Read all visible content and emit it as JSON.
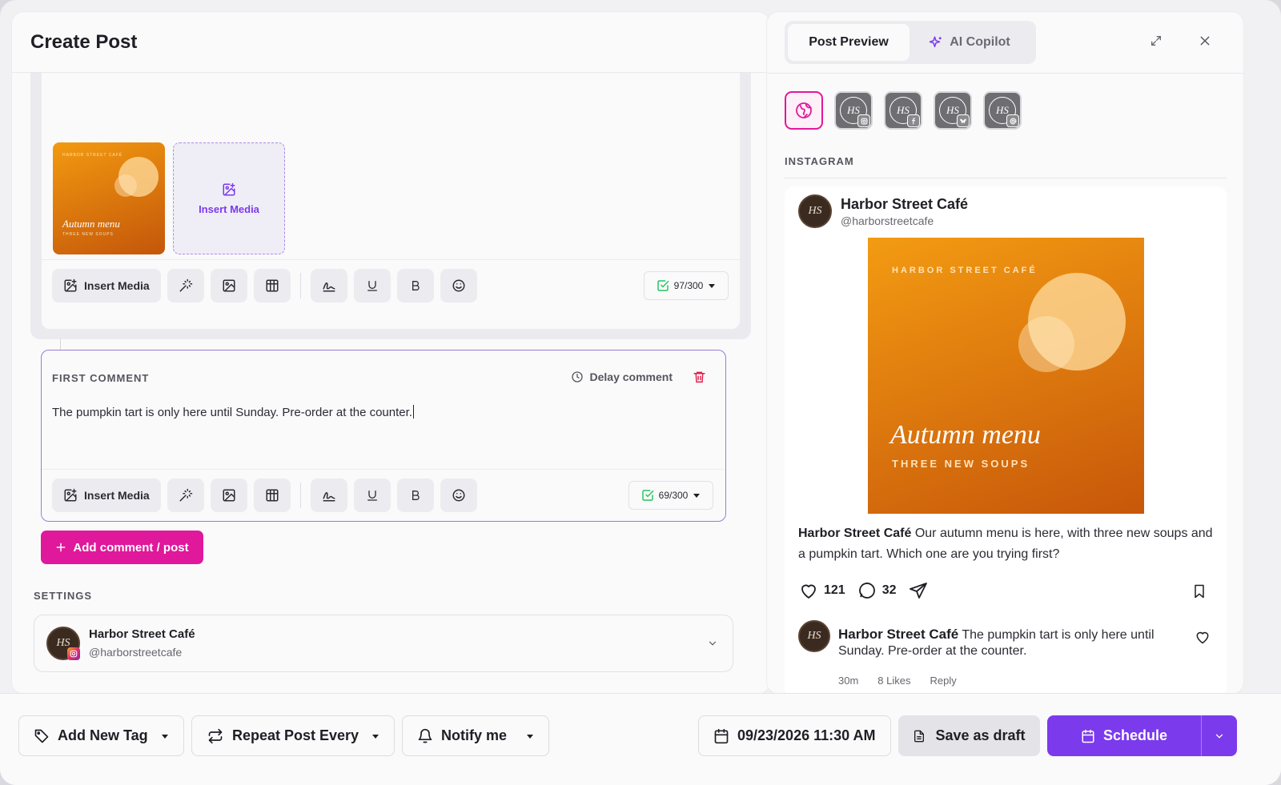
{
  "header": {
    "title": "Create Post"
  },
  "editor": {
    "thumb": {
      "brand": "HARBOR STREET CAFÉ",
      "title": "Autumn menu",
      "subtitle": "THREE NEW SOUPS"
    },
    "insert_tile_label": "Insert Media",
    "toolbar": {
      "insert_media_label": "Insert Media",
      "counter": "97/300"
    }
  },
  "first_comment": {
    "label": "FIRST COMMENT",
    "delay_label": "Delay comment",
    "text": "The pumpkin tart is only here until Sunday. Pre-order at the counter.",
    "toolbar": {
      "insert_media_label": "Insert Media",
      "counter": "69/300"
    }
  },
  "add_comment_label": "Add comment / post",
  "settings": {
    "label": "SETTINGS",
    "account": {
      "avatar": "HS",
      "name": "Harbor Street Café",
      "handle": "@harborstreetcafe"
    }
  },
  "preview": {
    "tabs": [
      {
        "label": "Post Preview"
      },
      {
        "label": "AI Copilot"
      }
    ],
    "platform_avatars": [
      "HS",
      "HS",
      "HS",
      "HS"
    ],
    "section_label": "INSTAGRAM",
    "post": {
      "avatar": "HS",
      "name": "Harbor Street Café",
      "handle": "@harborstreetcafe",
      "image": {
        "brand": "HARBOR STREET CAFÉ",
        "title": "Autumn menu",
        "subtitle": "THREE NEW SOUPS"
      },
      "caption_name": "Harbor Street Café",
      "caption_text": " Our autumn menu is here, with three new soups and a pumpkin tart. Which one are you trying first?",
      "likes": "121",
      "comments": "32",
      "comment": {
        "avatar": "HS",
        "name": "Harbor Street Café",
        "text": " The pumpkin tart is only here until Sunday. Pre-order at the counter.",
        "time": "30m",
        "likes": "8 Likes",
        "reply": "Reply"
      }
    }
  },
  "footer": {
    "tag_label": "Add New Tag",
    "repeat_label": "Repeat Post Every",
    "notify_label": "Notify me",
    "datetime": "09/23/2026 11:30 AM",
    "draft_label": "Save as draft",
    "schedule_label": "Schedule"
  },
  "colors": {
    "accent": "#7c3aed",
    "pink": "#e0189b",
    "danger": "#e11d48",
    "check": "#22c55e"
  }
}
